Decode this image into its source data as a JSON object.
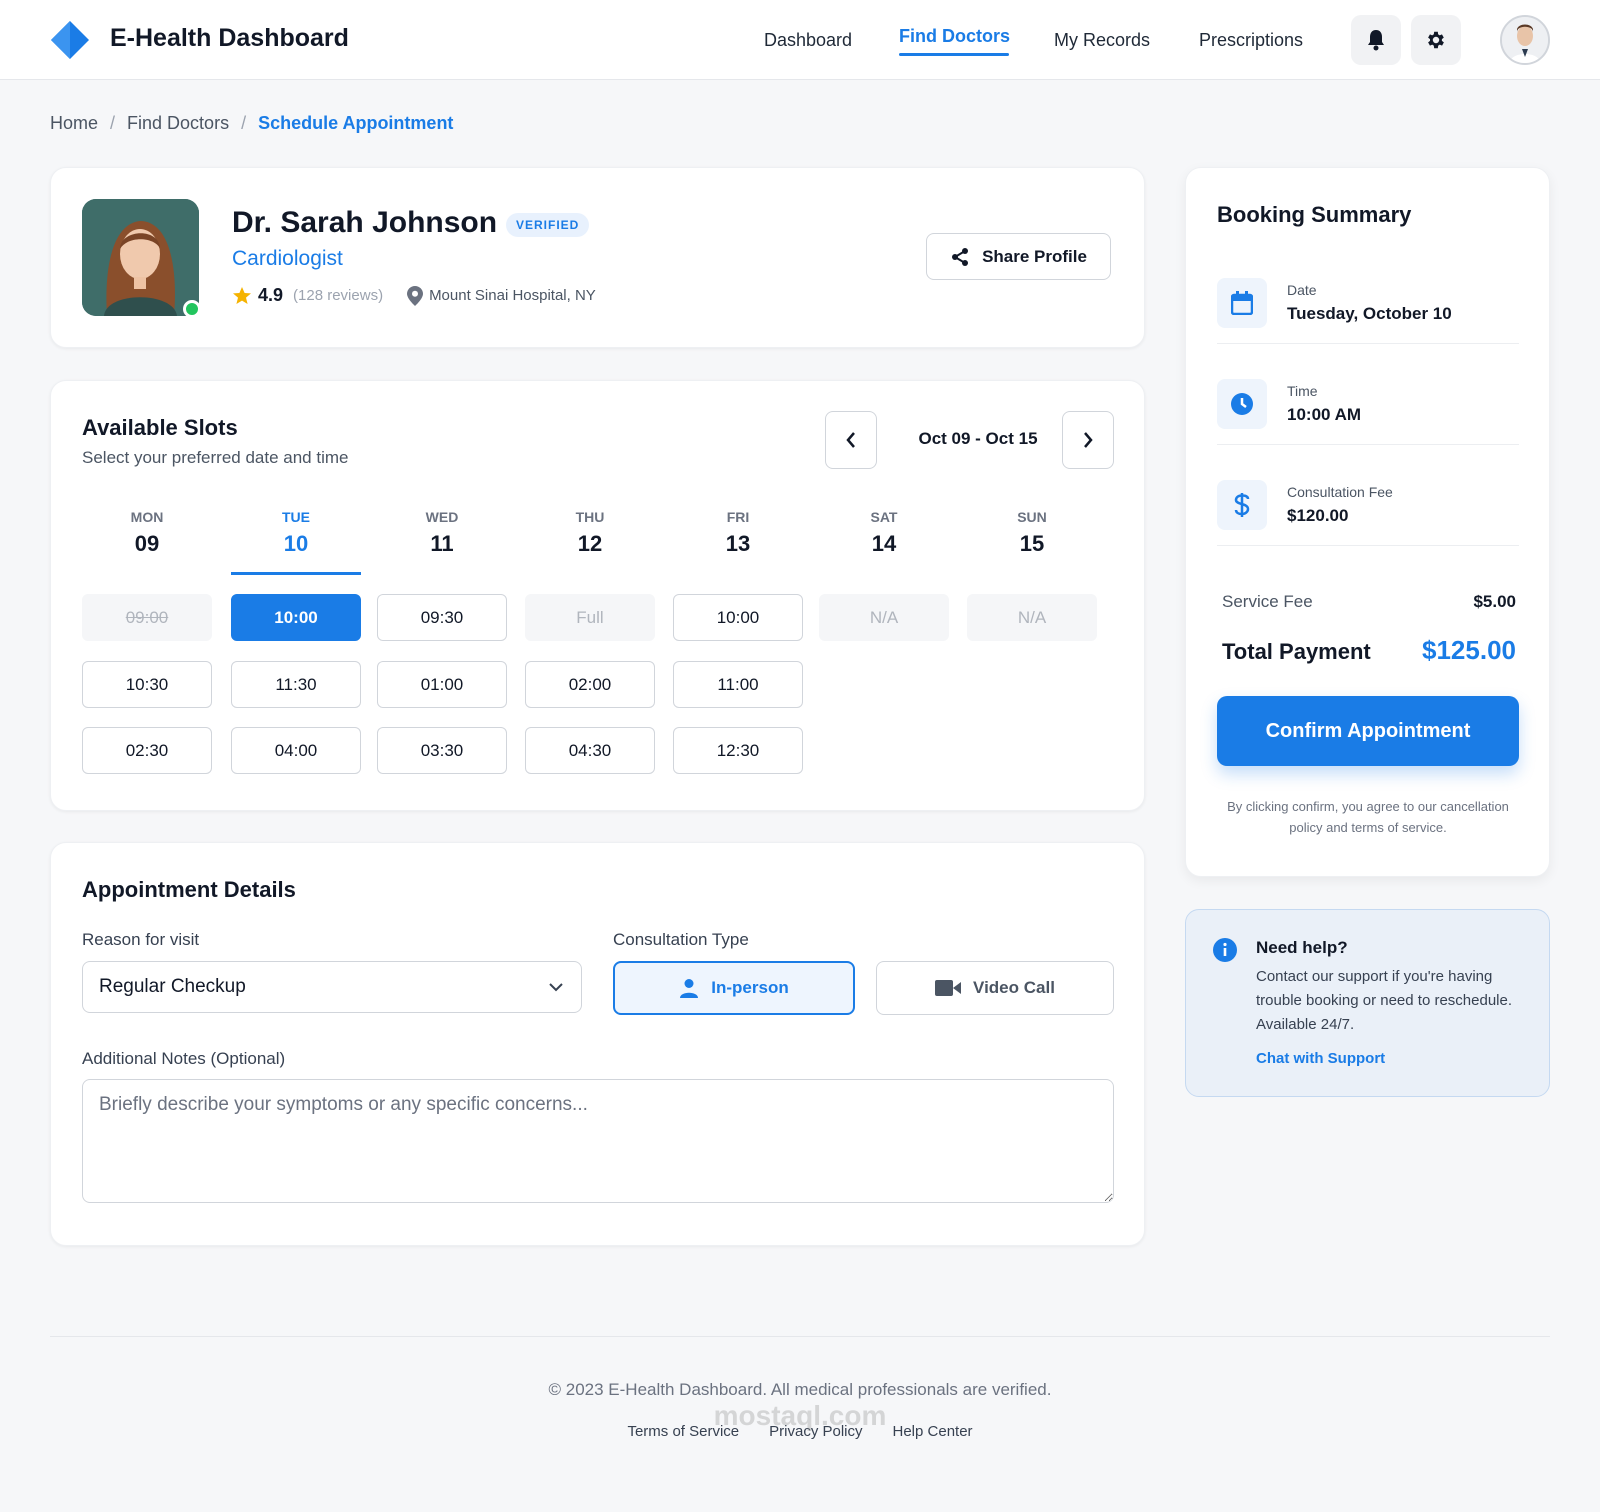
{
  "header": {
    "brand": "E-Health Dashboard",
    "nav": [
      "Dashboard",
      "Find Doctors",
      "My Records",
      "Prescriptions"
    ],
    "active_nav": "Find Doctors",
    "icons": [
      "bell-icon",
      "gear-icon"
    ],
    "accent": "#1a7ce6"
  },
  "breadcrumb": [
    "Home",
    "Find Doctors",
    "Schedule Appointment"
  ],
  "doctor": {
    "name": "Dr. Sarah Johnson",
    "badge": "VERIFIED",
    "specialty": "Cardiologist",
    "rating": "4.9",
    "reviews": "(128 reviews)",
    "location": "Mount Sinai Hospital, NY",
    "share_label": "Share Profile"
  },
  "slots": {
    "title": "Available Slots",
    "subtitle": "Select your preferred date and time",
    "week_range": "Oct 09 - Oct 15",
    "days": [
      {
        "name": "MON",
        "num": "09",
        "times": [
          {
            "t": "09:00",
            "s": "struck"
          },
          {
            "t": "10:30",
            "s": "open"
          },
          {
            "t": "02:30",
            "s": "open"
          }
        ]
      },
      {
        "name": "TUE",
        "num": "10",
        "times": [
          {
            "t": "10:00",
            "s": "selected"
          },
          {
            "t": "11:30",
            "s": "open"
          },
          {
            "t": "04:00",
            "s": "open"
          }
        ]
      },
      {
        "name": "WED",
        "num": "11",
        "times": [
          {
            "t": "09:30",
            "s": "open"
          },
          {
            "t": "01:00",
            "s": "open"
          },
          {
            "t": "03:30",
            "s": "open"
          }
        ]
      },
      {
        "name": "THU",
        "num": "12",
        "times": [
          {
            "t": "Full",
            "s": "disabled"
          },
          {
            "t": "02:00",
            "s": "open"
          },
          {
            "t": "04:30",
            "s": "open"
          }
        ]
      },
      {
        "name": "FRI",
        "num": "13",
        "times": [
          {
            "t": "10:00",
            "s": "open"
          },
          {
            "t": "11:00",
            "s": "open"
          },
          {
            "t": "12:30",
            "s": "open"
          }
        ]
      },
      {
        "name": "SAT",
        "num": "14",
        "times": [
          {
            "t": "N/A",
            "s": "disabled"
          }
        ]
      },
      {
        "name": "SUN",
        "num": "15",
        "times": [
          {
            "t": "N/A",
            "s": "disabled"
          }
        ]
      }
    ],
    "active_day": "TUE"
  },
  "details": {
    "title": "Appointment Details",
    "reason_label": "Reason for visit",
    "reason_value": "Regular Checkup",
    "type_label": "Consultation Type",
    "type_options": [
      "In-person",
      "Video Call"
    ],
    "type_selected": "In-person",
    "notes_label": "Additional Notes (Optional)",
    "notes_placeholder": "Briefly describe your symptoms or any specific concerns..."
  },
  "summary": {
    "title": "Booking Summary",
    "rows": [
      {
        "label": "Date",
        "value": "Tuesday, October 10",
        "icon": "calendar-icon"
      },
      {
        "label": "Time",
        "value": "10:00 AM",
        "icon": "clock-icon"
      },
      {
        "label": "Consultation Fee",
        "value": "$120.00",
        "icon": "dollar-icon"
      }
    ],
    "service_fee_label": "Service Fee",
    "service_fee_value": "$5.00",
    "total_label": "Total Payment",
    "total_value": "$125.00",
    "confirm_label": "Confirm Appointment",
    "disclaimer": "By clicking confirm, you agree to our cancellation policy and terms of service."
  },
  "help": {
    "title": "Need help?",
    "text": "Contact our support if you're having trouble booking or need to reschedule. Available 24/7.",
    "link": "Chat with Support"
  },
  "footer": {
    "copyright": "© 2023 E-Health Dashboard. All medical professionals are verified.",
    "links": [
      "Terms of Service",
      "Privacy Policy",
      "Help Center"
    ],
    "watermark": "mostaql.com"
  }
}
